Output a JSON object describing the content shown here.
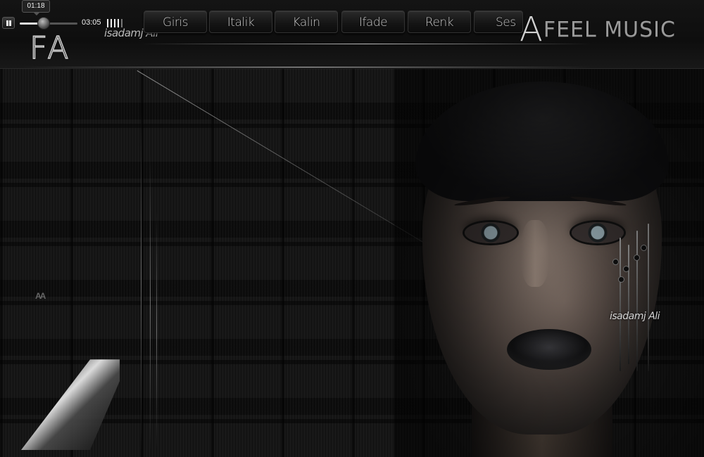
{
  "player": {
    "state": "playing",
    "current_time": "01:18",
    "duration": "03:05",
    "progress_fraction": 0.42,
    "volume_level": 4
  },
  "nav": {
    "tabs": [
      {
        "key": "girls",
        "label": "Giris"
      },
      {
        "key": "italik",
        "label": "Italik"
      },
      {
        "key": "kalin",
        "label": "Kalin"
      },
      {
        "key": "ifade",
        "label": "Ifade"
      },
      {
        "key": "renk",
        "label": "Renk"
      },
      {
        "key": "ses",
        "label": "Ses"
      }
    ]
  },
  "brand": {
    "initial": "A",
    "name": "FEEL MUSIC"
  },
  "logo": {
    "text": "FA"
  },
  "signature": {
    "text": "isadamj Ali"
  },
  "portrait_signature": {
    "text": "isadamj Ali"
  },
  "mini_mark": {
    "text": "AA"
  },
  "colors": {
    "background": "#0b0b0b",
    "accent": "#c8c8c8",
    "tab_bg": "#141414"
  }
}
